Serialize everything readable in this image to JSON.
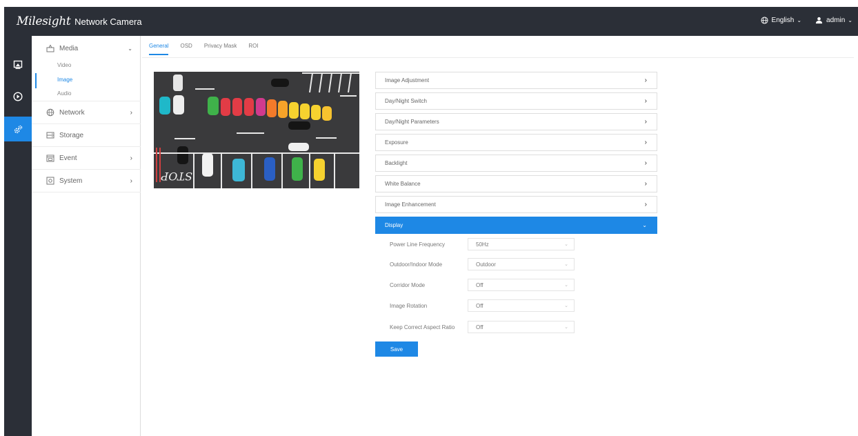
{
  "brand": {
    "logo": "Milesight",
    "subtitle": "Network Camera"
  },
  "header": {
    "language_label": "English",
    "user_label": "admin"
  },
  "rail": {
    "active_index": 2
  },
  "menu": {
    "media": {
      "label": "Media",
      "items": [
        "Video",
        "Image",
        "Audio"
      ],
      "active_item": "Image"
    },
    "network": "Network",
    "storage": "Storage",
    "event": "Event",
    "system": "System"
  },
  "tabs": [
    "General",
    "OSD",
    "Privacy Mask",
    "ROI"
  ],
  "active_tab": "General",
  "panels": [
    "Image Adjustment",
    "Day/Night Switch",
    "Day/Night Parameters",
    "Exposure",
    "Backlight",
    "White Balance",
    "Image Enhancement",
    "Display"
  ],
  "open_panel": "Display",
  "display_settings": {
    "power_line_frequency": {
      "label": "Power Line Frequency",
      "value": "50Hz"
    },
    "outdoor_indoor_mode": {
      "label": "Outdoor/Indoor Mode",
      "value": "Outdoor"
    },
    "corridor_mode": {
      "label": "Corridor Mode",
      "value": "Off"
    },
    "image_rotation": {
      "label": "Image Rotation",
      "value": "Off"
    },
    "keep_aspect_ratio": {
      "label": "Keep Correct Aspect Ratio",
      "value": "Off"
    }
  },
  "save_label": "Save",
  "preview": {
    "road_text": "STOP"
  },
  "colors": {
    "accent": "#1e88e5",
    "topbar": "#2b2f37"
  }
}
